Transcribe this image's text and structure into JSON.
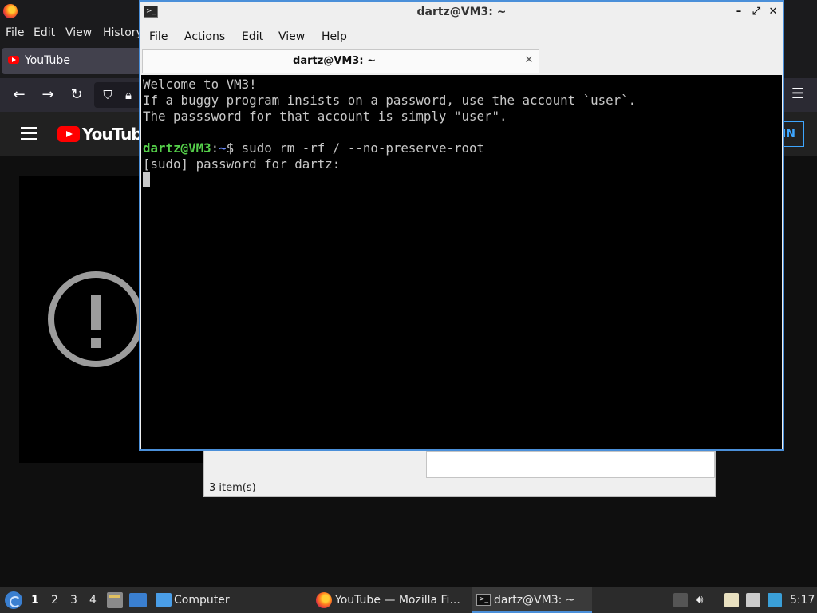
{
  "firefox": {
    "menu": [
      "File",
      "Edit",
      "View",
      "History"
    ],
    "tab_title": "YouTube",
    "youtube_logo": "YouTube",
    "signin_partial": "IN"
  },
  "file_manager": {
    "status": "3 item(s)"
  },
  "terminal": {
    "window_title": "dartz@VM3: ~",
    "menu": [
      "File",
      "Actions",
      "Edit",
      "View",
      "Help"
    ],
    "tab_title": "dartz@VM3: ~",
    "lines": [
      "Welcome to VM3!",
      "If a buggy program insists on a password, use the account `user`.",
      "The passsword for that account is simply \"user\"."
    ],
    "prompt_user": "dartz@VM3",
    "prompt_sep": ":",
    "prompt_path": "~",
    "prompt_dollar": "$ ",
    "command": "sudo rm -rf / --no-preserve-root",
    "sudo_prompt": "[sudo] password for dartz:"
  },
  "taskbar": {
    "workspaces": [
      "1",
      "2",
      "3",
      "4"
    ],
    "computer_label": "Computer",
    "firefox_task": "YouTube — Mozilla Fi...",
    "terminal_task": "dartz@VM3: ~",
    "clock": "5:17"
  },
  "icons": {
    "terminal": "terminal-icon",
    "firefox": "firefox-icon",
    "error": "error-exclamation-icon"
  }
}
